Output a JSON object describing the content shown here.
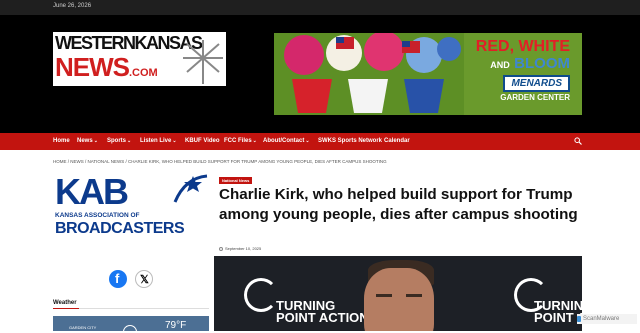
{
  "topbar": {
    "date": "June 26, 2026"
  },
  "logo": {
    "line1": "WESTERNKANSAS",
    "line2": "NEWS",
    "suffix": ".COM"
  },
  "ad": {
    "red": "RED, WHITE",
    "and": "AND",
    "bloom": "BLOOM",
    "brand": "MENARDS",
    "sub": "GARDEN CENTER"
  },
  "nav": {
    "items": [
      {
        "label": "Home",
        "dropdown": false
      },
      {
        "label": "News",
        "dropdown": true
      },
      {
        "label": "Sports",
        "dropdown": true
      },
      {
        "label": "Listen Live",
        "dropdown": true
      },
      {
        "label": "KBUF Video",
        "dropdown": false
      },
      {
        "label": "FCC Files",
        "dropdown": true
      },
      {
        "label": "About/Contact",
        "dropdown": true
      },
      {
        "label": "SWKS Sports Network",
        "dropdown": false
      },
      {
        "label": "Calendar",
        "dropdown": false
      }
    ],
    "caret": "⌄"
  },
  "breadcrumb": "HOME / NEWS / NATIONAL NEWS / CHARLIE KIRK, WHO HELPED BUILD SUPPORT FOR TRUMP AMONG YOUNG PEOPLE, DIES AFTER CAMPUS SHOOTING",
  "sidebar": {
    "kab": {
      "letters": "KAB",
      "sub": "KANSAS ASSOCIATION OF",
      "big": "BROADCASTERS"
    },
    "social": {
      "facebook": "f",
      "x": "𝕏"
    },
    "weather": {
      "title": "Weather",
      "city": "GARDEN CITY",
      "temp": "79°F"
    }
  },
  "article": {
    "category": "National News",
    "headline": "Charlie Kirk, who helped build support for Trump among young people, dies after campus shooting",
    "date": "September 10, 2025",
    "photo_text": "TURNING POINT ACTION"
  },
  "watermark": "ScanMalware",
  "colors": {
    "nav_red": "#c2140f",
    "header_black": "#000000",
    "topbar": "#1f1f1f",
    "kab_blue": "#0c3a8c"
  }
}
